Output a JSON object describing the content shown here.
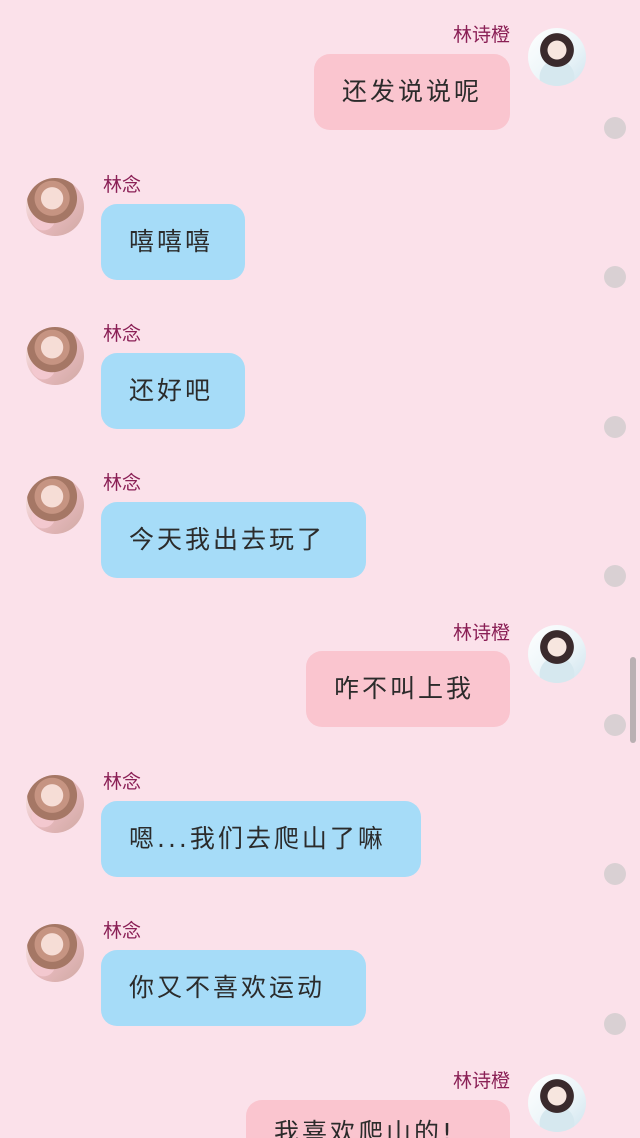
{
  "messages": [
    {
      "sender": "林诗橙",
      "text": "还发说说呢",
      "side": "right"
    },
    {
      "sender": "林念",
      "text": "嘻嘻嘻",
      "side": "left"
    },
    {
      "sender": "林念",
      "text": "还好吧",
      "side": "left"
    },
    {
      "sender": "林念",
      "text": "今天我出去玩了",
      "side": "left"
    },
    {
      "sender": "林诗橙",
      "text": "咋不叫上我",
      "side": "right"
    },
    {
      "sender": "林念",
      "text": "嗯...我们去爬山了嘛",
      "side": "left"
    },
    {
      "sender": "林念",
      "text": "你又不喜欢运动",
      "side": "left"
    },
    {
      "sender": "林诗橙",
      "text": "我喜欢爬山的!",
      "side": "right"
    }
  ]
}
